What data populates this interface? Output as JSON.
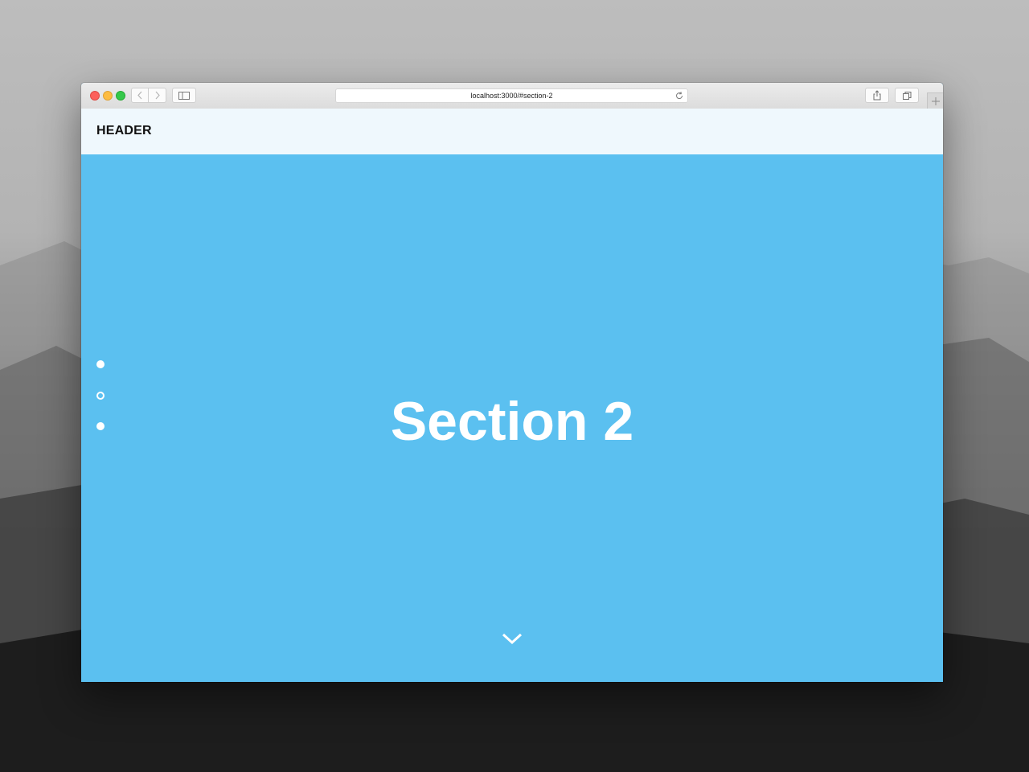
{
  "browser": {
    "url": "localhost:3000/#section-2",
    "icons": {
      "back": "chevron-left-icon",
      "forward": "chevron-right-icon",
      "sidebar": "sidebar-icon",
      "reload": "reload-icon",
      "share": "share-icon",
      "tabs": "tabs-overview-icon",
      "new_tab": "plus-icon"
    }
  },
  "page": {
    "header": {
      "logo": "HEADER"
    },
    "section": {
      "title": "Section 2",
      "background_color": "#5bc0f0"
    },
    "nav_dots": [
      {
        "state": "inactive"
      },
      {
        "state": "active"
      },
      {
        "state": "inactive"
      }
    ],
    "scroll_icon": "chevron-down-icon"
  },
  "colors": {
    "close": "#fc605c",
    "minimize": "#fdbc40",
    "maximize": "#34c84a",
    "header_bg": "#eff8fd"
  }
}
